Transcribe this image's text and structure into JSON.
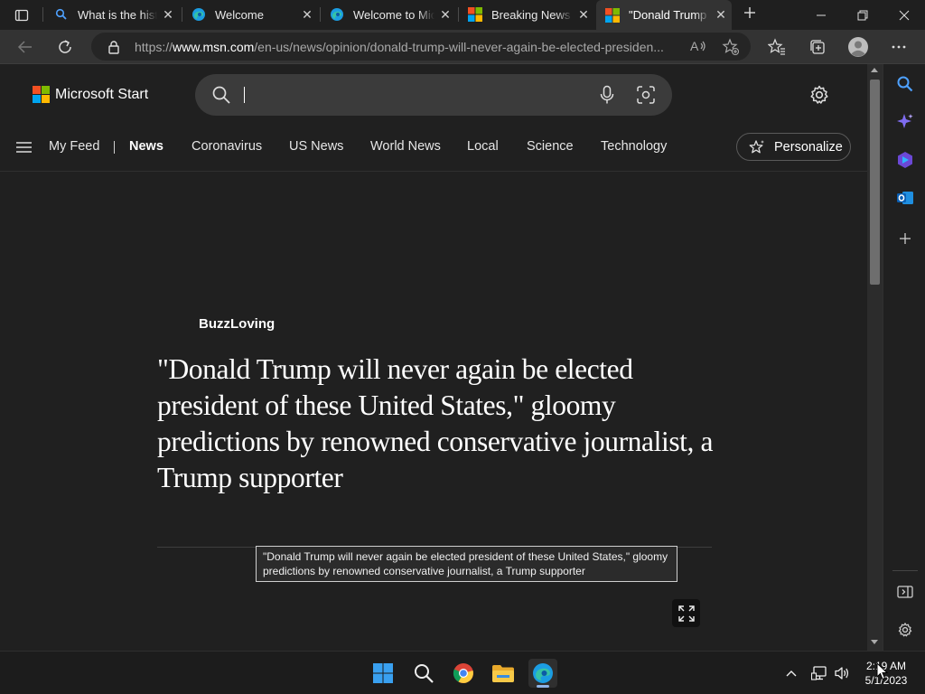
{
  "browser": {
    "tabs": [
      {
        "title": "What is the histo",
        "icon": "bing-search-icon"
      },
      {
        "title": "Welcome",
        "icon": "edge-icon"
      },
      {
        "title": "Welcome to Micr",
        "icon": "edge-icon"
      },
      {
        "title": "Breaking News S",
        "icon": "microsoft-icon"
      },
      {
        "title": "\"Donald Trump",
        "icon": "microsoft-icon",
        "active": true
      }
    ],
    "url_prefix": "https://",
    "url_domain": "www.msn.com",
    "url_path": "/en-us/news/opinion/donald-trump-will-never-again-be-elected-presiden..."
  },
  "header": {
    "logo_text": "Microsoft Start",
    "search_placeholder": ""
  },
  "nav": {
    "items": [
      "My Feed",
      "News",
      "Coronavirus",
      "US News",
      "World News",
      "Local",
      "Science",
      "Technology"
    ],
    "active": "News",
    "personalize_label": "Personalize"
  },
  "article": {
    "source": "BuzzLoving",
    "headline": "\"Donald Trump will never again be elected president of these United States,\" gloomy predictions by renowned conservative journalist, a Trump supporter",
    "tooltip": "\"Donald Trump will never again be elected president of these United States,\" gloomy predictions by renowned conservative journalist, a Trump supporter"
  },
  "taskbar": {
    "time": "2:19 AM",
    "date": "5/1/2023"
  },
  "colors": {
    "ms_red": "#f25022",
    "ms_green": "#7fba00",
    "ms_blue": "#00a4ef",
    "ms_yellow": "#ffb900",
    "page_bg": "#202020"
  }
}
